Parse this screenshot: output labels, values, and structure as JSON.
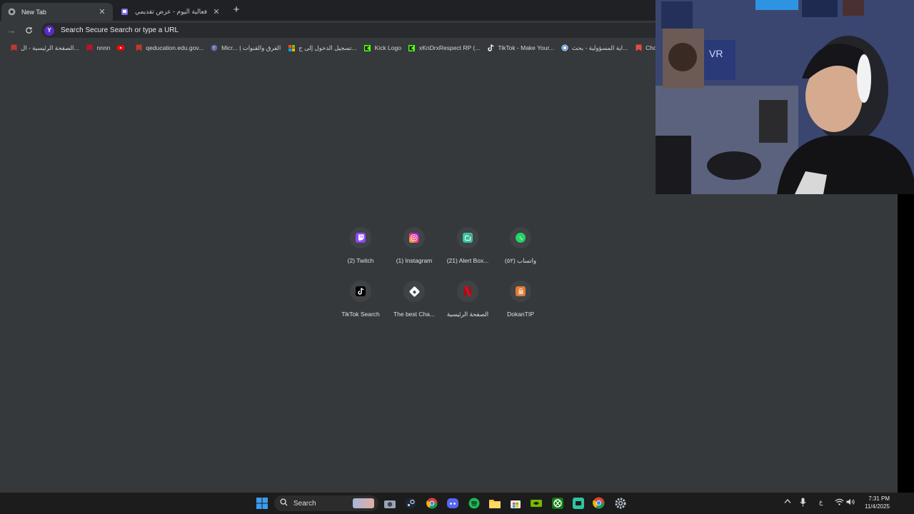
{
  "tabs": [
    {
      "title": "New Tab",
      "active": true,
      "icon": "chrome-icon"
    },
    {
      "title": "فعالية اليوم - عرض تقديمي",
      "active": false,
      "icon": "twitch-icon"
    }
  ],
  "toolbar": {
    "omnibox_placeholder": "Search Secure Search or type a URL"
  },
  "bookmarks": [
    {
      "label": "الصفحة الرئيسية - ال...",
      "icon": "school-icon",
      "color": "#c0392b"
    },
    {
      "label": "nnnn",
      "icon": "bookmark-red-icon",
      "color": "#c1121f"
    },
    {
      "label": "",
      "icon": "youtube-icon",
      "color": "#ff0000"
    },
    {
      "label": "qeducation.edu.gov...",
      "icon": "school-icon",
      "color": "#c0392b"
    },
    {
      "label": "Micr... | الفرق والقنوات",
      "icon": "teams-icon",
      "color": "#6264a7"
    },
    {
      "label": "تسجيل الدخول إلى ح...",
      "icon": "microsoft-icon",
      "color": "#f25022"
    },
    {
      "label": "Kick Logo",
      "icon": "kick-icon",
      "color": "#53fc18"
    },
    {
      "label": "xKnDrxRespect RP (...",
      "icon": "kick-icon",
      "color": "#53fc18"
    },
    {
      "label": "TikTok - Make Your...",
      "icon": "tiktok-icon",
      "color": "#ffffff"
    },
    {
      "label": "اية المسؤولية - بحث...",
      "icon": "google-icon",
      "color": "#4285f4"
    },
    {
      "label": "Choose a flig...",
      "icon": "plane-icon",
      "color": "#e74c3c"
    }
  ],
  "shortcuts": [
    {
      "label": "(2) Twitch",
      "icon": "twitch-icon",
      "color": "#9146ff"
    },
    {
      "label": "(1) Instagram",
      "icon": "instagram-icon",
      "color": "#e1306c"
    },
    {
      "label": "(21) Alert Box...",
      "icon": "alert-box-icon",
      "color": "#31c3a2"
    },
    {
      "label": "واتساب (٥٢)",
      "icon": "whatsapp-icon",
      "color": "#25d366"
    },
    {
      "label": "TikTok Search",
      "icon": "tiktok-icon",
      "color": "#000000"
    },
    {
      "label": "The best Cha...",
      "icon": "chat-icon",
      "color": "#ffffff"
    },
    {
      "label": "الصفحة الرئيسية",
      "icon": "netflix-icon",
      "color": "#b20710"
    },
    {
      "label": "DokanTIP",
      "icon": "shopping-bag-icon",
      "color": "#e07b39"
    }
  ],
  "taskbar": {
    "search_label": "Search",
    "language": "ع",
    "time": "7:31 PM",
    "date": "11/4/2025"
  }
}
